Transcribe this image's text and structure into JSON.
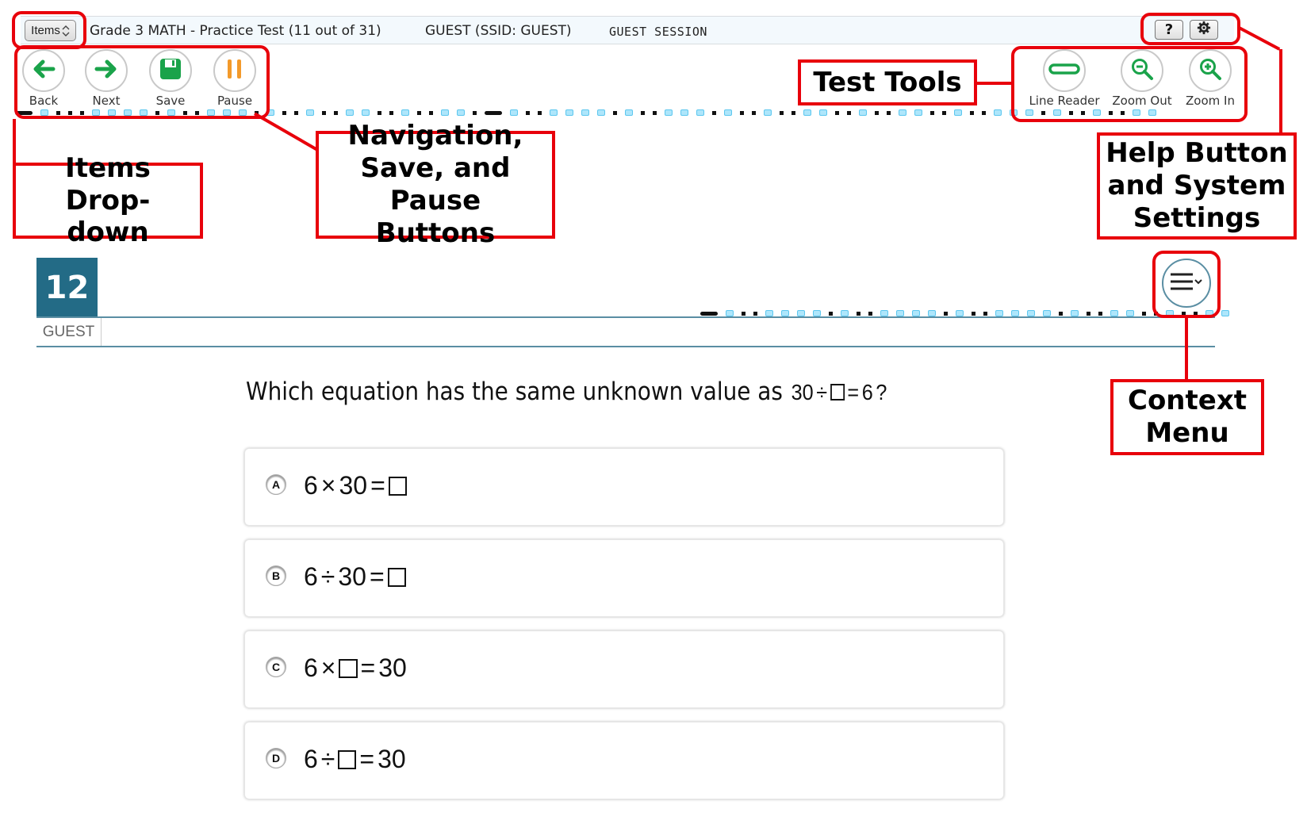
{
  "topbar": {
    "items_label": "Items",
    "test_title": "Grade 3 MATH - Practice Test (11 out of 31)",
    "student": "GUEST (SSID: GUEST)",
    "session": "GUEST SESSION",
    "help_label": "?",
    "settings_icon": "gear-icon"
  },
  "nav_buttons": [
    {
      "label": "Back",
      "icon": "arrow-left-icon",
      "color": "#1aa34a"
    },
    {
      "label": "Next",
      "icon": "arrow-right-icon",
      "color": "#1aa34a"
    },
    {
      "label": "Save",
      "icon": "floppy-disk-icon",
      "color": "#1aa34a"
    },
    {
      "label": "Pause",
      "icon": "pause-icon",
      "color": "#f39a2b"
    }
  ],
  "test_tools": [
    {
      "label": "Line Reader",
      "icon": "line-reader-icon"
    },
    {
      "label": "Zoom Out",
      "icon": "zoom-out-icon"
    },
    {
      "label": "Zoom In",
      "icon": "zoom-in-icon"
    }
  ],
  "callouts": {
    "items_dropdown": "Items Drop-down",
    "navigation": "Navigation, Save, and Pause Buttons",
    "test_tools": "Test Tools",
    "help_settings": "Help Button and System Settings",
    "context_menu": "Context Menu"
  },
  "item": {
    "number": "12",
    "student_tab": "GUEST",
    "context_menu_icon": "hamburger-chevron-icon",
    "question_text": "Which equation has the same unknown value as ",
    "question_math": [
      "30",
      "÷",
      "box",
      "=",
      "6",
      "?"
    ],
    "options": [
      {
        "letter": "A",
        "parts": [
          "6",
          "×",
          "30",
          "=",
          "box"
        ]
      },
      {
        "letter": "B",
        "parts": [
          "6",
          "÷",
          "30",
          "=",
          "box"
        ]
      },
      {
        "letter": "C",
        "parts": [
          "6",
          "×",
          "box",
          "=",
          "30"
        ]
      },
      {
        "letter": "D",
        "parts": [
          "6",
          "÷",
          "box",
          "=",
          "30"
        ]
      }
    ]
  },
  "colors": {
    "accent_red": "#e8000b",
    "item_number_bg": "#236b86",
    "nav_green": "#1aa34a",
    "pause_orange": "#f39a2b",
    "dot_unanswered": "#aee6fb"
  }
}
